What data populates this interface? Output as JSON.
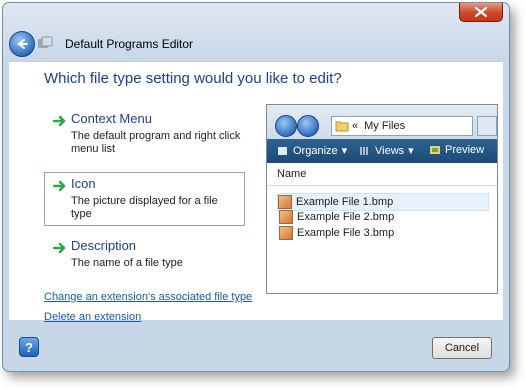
{
  "window": {
    "title": "Default Programs Editor",
    "question": "Which file type setting would you like to edit?"
  },
  "options": [
    {
      "title": "Context Menu",
      "description": "The default program and right click menu list"
    },
    {
      "title": "Icon",
      "description": "The picture displayed for a file type"
    },
    {
      "title": "Description",
      "description": "The name of a file type"
    }
  ],
  "links": {
    "change_association": "Change an extension's associated file type",
    "delete_extension": "Delete an extension"
  },
  "preview": {
    "address_prefix": "«",
    "address": "My Files",
    "toolbar": {
      "organize": "Organize",
      "views": "Views",
      "preview": "Preview"
    },
    "column_name": "Name",
    "files": [
      "Example File 1.bmp",
      "Example File 2.bmp",
      "Example File 3.bmp"
    ]
  },
  "buttons": {
    "help": "?",
    "cancel": "Cancel"
  },
  "colors": {
    "accent": "#1c3f94",
    "arrow": "#2aa84a",
    "close": "#c0351c"
  }
}
